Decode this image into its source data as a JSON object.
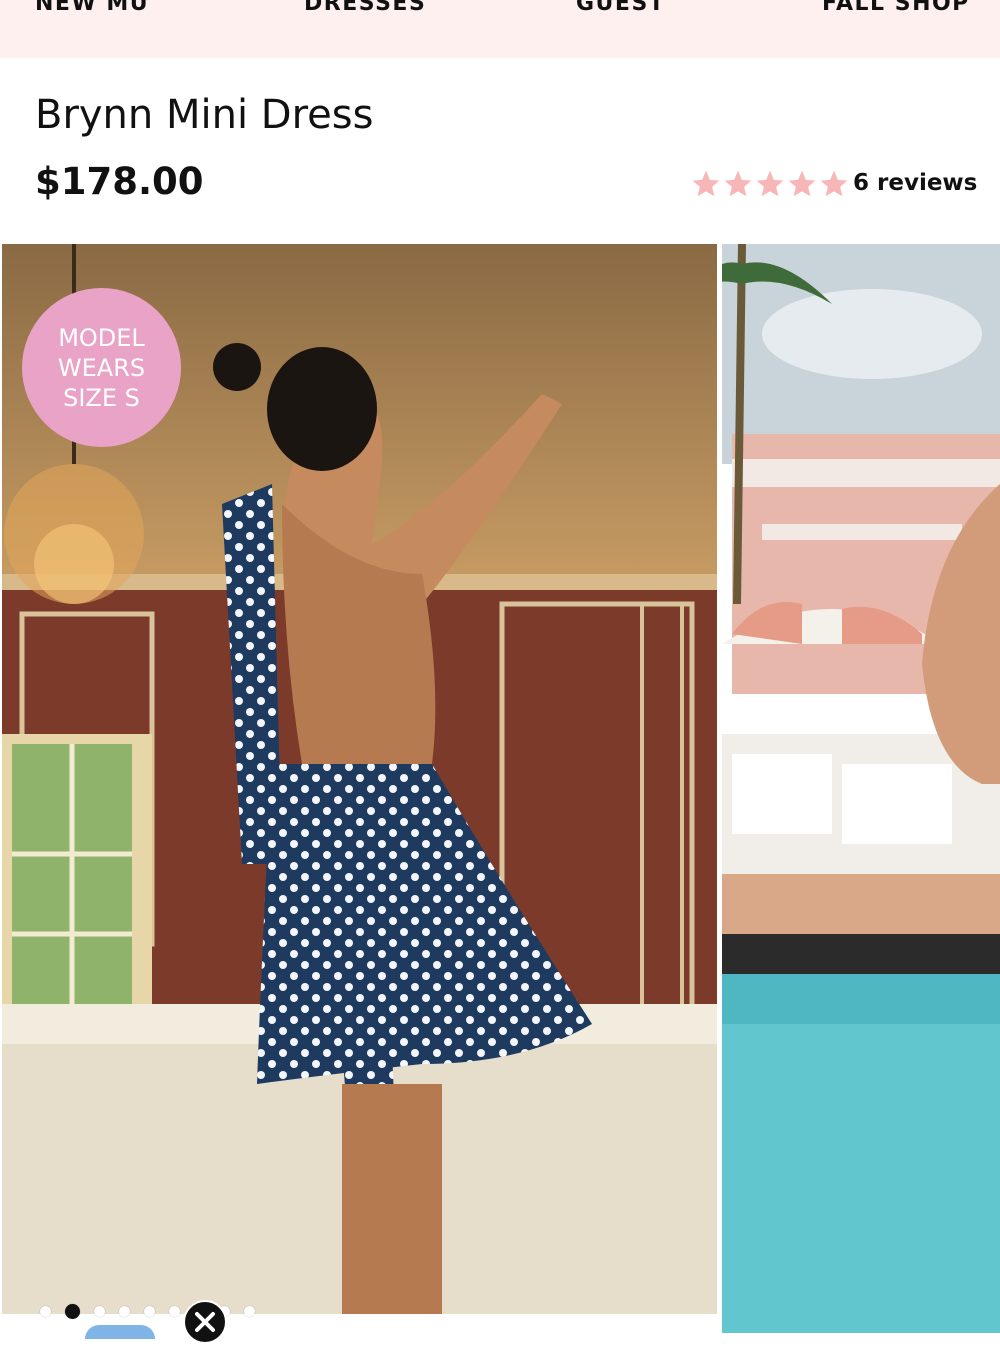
{
  "nav": {
    "items": [
      "NEW MU",
      "DRESSES",
      "GUEST",
      "FALL SHOP"
    ]
  },
  "product": {
    "title": "Brynn Mini Dress",
    "price": "$178.00",
    "rating": 5,
    "reviews_label": "6 reviews"
  },
  "badge": {
    "line1": "MODEL",
    "line2": "WEARS",
    "line3": "SIZE S"
  },
  "gallery": {
    "total_dots": 9,
    "active_index": 1
  },
  "colors": {
    "nav_bg": "#fdf0ef",
    "star": "#f7b6b8",
    "badge": "#e9a3c7"
  },
  "icons": {
    "close": "close-icon",
    "star": "star-icon"
  }
}
